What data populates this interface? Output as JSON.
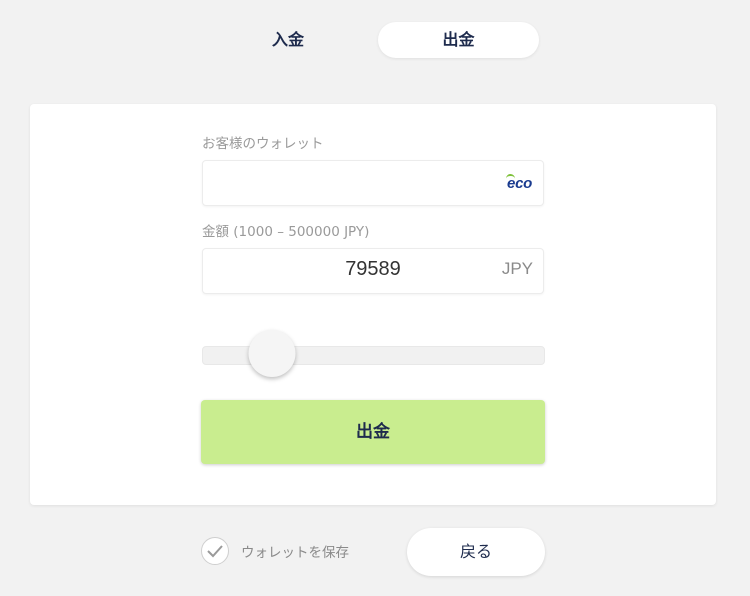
{
  "tabs": {
    "deposit": "入金",
    "withdraw": "出金",
    "active": "withdraw"
  },
  "form": {
    "wallet_label": "お客様のウォレット",
    "wallet_value": "",
    "wallet_provider_logo": "eco",
    "amount_label": "金額 (1000 – 500000 JPY)",
    "amount_value": "79589",
    "currency": "JPY",
    "slider": {
      "min": 1000,
      "max": 500000,
      "value": 79589
    },
    "submit_label": "出金"
  },
  "footer": {
    "save_wallet_label": "ウォレットを保存",
    "save_wallet_checked": true,
    "back_label": "戻る"
  },
  "colors": {
    "background": "#f2f2f2",
    "submit_button": "#c9ed8f",
    "text_dark": "#1e2b4d",
    "eco_blue": "#1a3b8f",
    "eco_green": "#7fc13a"
  }
}
